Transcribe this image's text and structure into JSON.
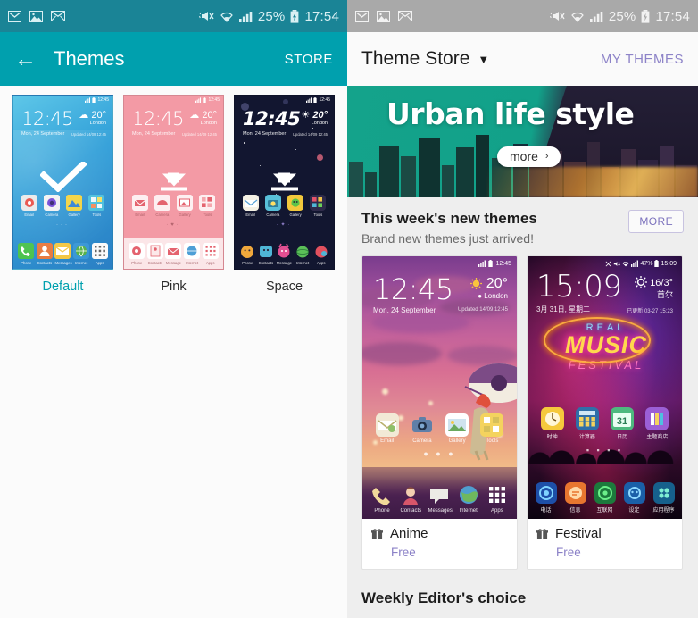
{
  "left_screen": {
    "status_bar": {
      "notification_icons": [
        "gmail-icon",
        "screenshot-icon",
        "envelope-icon"
      ],
      "vibrate_icon": "mute-vibrate-icon",
      "wifi_icon": "wifi-icon",
      "signal_icon": "signal-icon",
      "battery_percent": "25%",
      "battery_icon": "battery-charging-icon",
      "time": "17:54"
    },
    "app_bar": {
      "back_icon": "back-arrow-icon",
      "title": "Themes",
      "store_label": "STORE"
    },
    "themes": [
      {
        "name": "Default",
        "selected": true,
        "state_icon": "checkmark-icon",
        "preview": {
          "clock": "12:45",
          "date": "Mon, 24 September",
          "temperature": "20°",
          "city": "London",
          "updated": "Updated 14/09 12:45",
          "status_time": "12:45",
          "app_icons": [
            "Email",
            "Camera",
            "Gallery",
            "Tools"
          ],
          "dock_icons": [
            "Phone",
            "Contacts",
            "Messages",
            "Internet",
            "Apps"
          ]
        }
      },
      {
        "name": "Pink",
        "selected": false,
        "state_icon": "download-icon",
        "preview": {
          "clock": "12:45",
          "date": "Mon, 24 September",
          "temperature": "20°",
          "city": "London",
          "updated": "Updated 14/09 12:45",
          "status_time": "12:45",
          "app_icons": [
            "Email",
            "Camera",
            "Gallery",
            "Tools"
          ],
          "dock_icons": [
            "Phone",
            "Contacts",
            "Message",
            "Internet",
            "Apps"
          ]
        }
      },
      {
        "name": "Space",
        "selected": false,
        "state_icon": "download-icon",
        "preview": {
          "clock": "12:45",
          "date": "Mon, 24 September",
          "temperature": "20°",
          "city": "London",
          "updated": "Updated 14/09 12:45",
          "status_time": "12:45",
          "app_icons": [
            "Email",
            "Camera",
            "Gallery",
            "Tools"
          ],
          "dock_icons": [
            "Phone",
            "Contacts",
            "Message",
            "Internet",
            "Apps"
          ]
        }
      }
    ]
  },
  "right_screen": {
    "status_bar": {
      "notification_icons": [
        "gmail-icon",
        "screenshot-icon",
        "envelope-icon"
      ],
      "battery_percent": "25%",
      "time": "17:54"
    },
    "app_bar": {
      "title": "Theme Store",
      "dropdown_icon": "chevron-down-icon",
      "my_themes_label": "MY THEMES"
    },
    "banner": {
      "headline": "Urban life style",
      "more_label": "more",
      "more_chevron": "›"
    },
    "section_new": {
      "title": "This week's new themes",
      "subtitle": "Brand new themes just arrived!",
      "more_label": "MORE"
    },
    "cards": [
      {
        "name": "Anime",
        "price": "Free",
        "badge_icon": "gift-icon",
        "preview": {
          "clock": "12:45",
          "date": "Mon, 24 September",
          "temperature": "20°",
          "city": "London",
          "updated": "Updated 14/09 12:45",
          "status_time": "12:45",
          "app_icons": [
            "Email",
            "Camera",
            "Gallery",
            "Tools"
          ],
          "dock_icons": [
            "Phone",
            "Contacts",
            "Messages",
            "Internet",
            "Apps"
          ]
        }
      },
      {
        "name": "Festival",
        "price": "Free",
        "badge_icon": "gift-icon",
        "preview": {
          "clock": "15:09",
          "date": "3月 31日, 星期二",
          "temperature": "16/3°",
          "city": "首尔",
          "updated": "已更新 03-27 15:23",
          "status_time": "15:09",
          "status_battery": "47%",
          "neon_top": "REAL",
          "neon_mid": "MUSIC",
          "neon_bottom": "FESTIVAL",
          "app_icons": [
            "时钟",
            "计算器",
            "日历",
            "主题商店"
          ],
          "dock_icons": [
            "电话",
            "信息",
            "互联网",
            "设定",
            "应用程序"
          ]
        }
      }
    ],
    "section_weekly": {
      "title": "Weekly Editor's choice"
    }
  },
  "colors": {
    "teal_appbar": "#00a0ae",
    "teal_status": "#1a8496",
    "gray_status": "#a9a9a9",
    "purple_accent": "#8b81c7",
    "page_bg": "#eeeeee"
  }
}
